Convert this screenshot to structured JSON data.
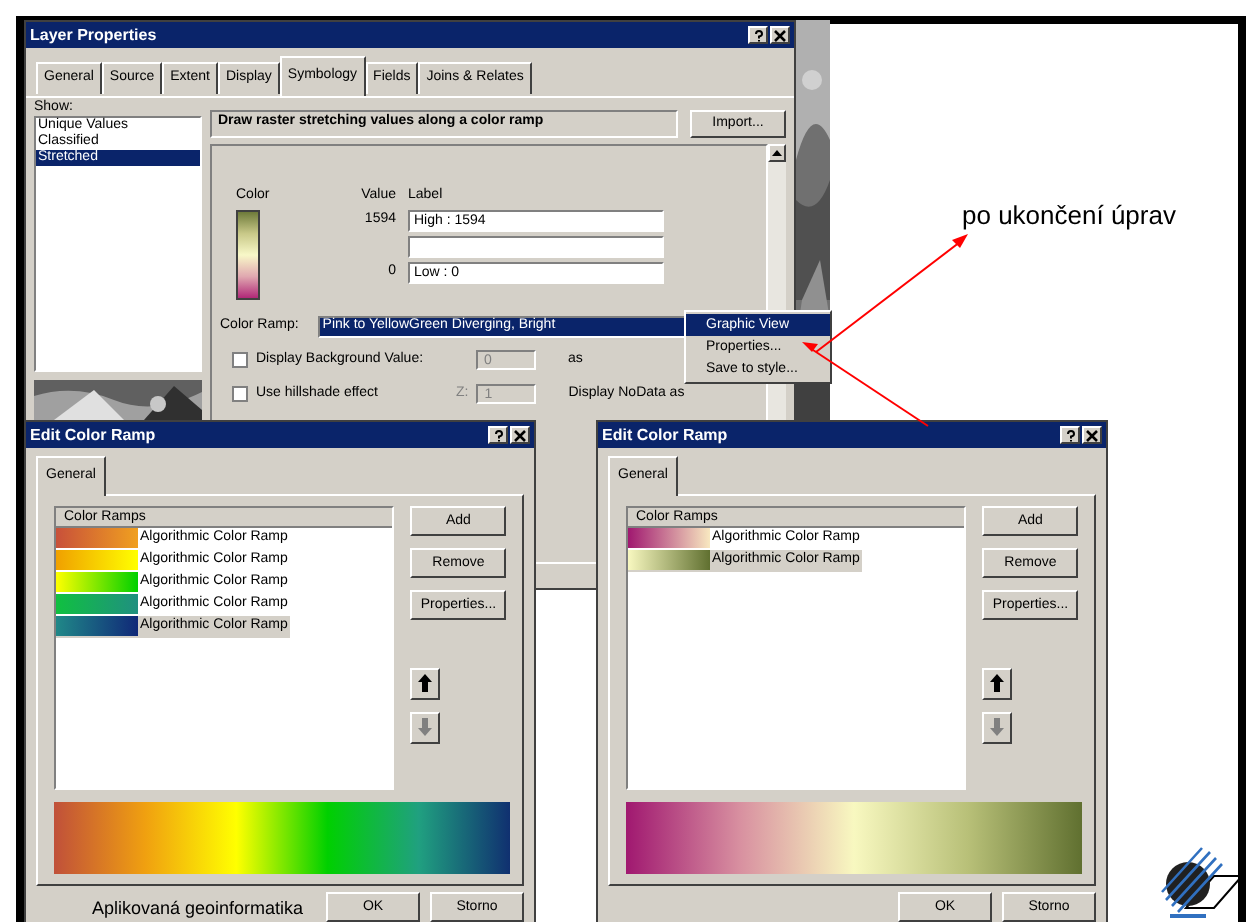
{
  "layer_properties": {
    "title": "Layer Properties",
    "tabs": [
      {
        "label": "General",
        "selected": false
      },
      {
        "label": "Source",
        "selected": false
      },
      {
        "label": "Extent",
        "selected": false
      },
      {
        "label": "Display",
        "selected": false
      },
      {
        "label": "Symbology",
        "selected": true
      },
      {
        "label": "Fields",
        "selected": false
      },
      {
        "label": "Joins & Relates",
        "selected": false
      }
    ],
    "show_label": "Show:",
    "show_items": [
      {
        "label": "Unique Values",
        "selected": false
      },
      {
        "label": "Classified",
        "selected": false
      },
      {
        "label": "Stretched",
        "selected": true
      }
    ],
    "header": "Draw raster stretching values along a color ramp",
    "import_button": "Import...",
    "color_header": "Color",
    "value_header": "Value",
    "label_header": "Label",
    "rows": [
      {
        "kind": "value",
        "value": "1594",
        "label": "High : 1594"
      },
      {
        "kind": "blank"
      },
      {
        "kind": "value",
        "value": "0",
        "label": "Low : 0"
      }
    ],
    "color_ramp_label": "Color Ramp:",
    "color_ramp_value": "Pink to YellowGreen Diverging, Bright",
    "options": [
      {
        "label": "Display Background Value:",
        "checked": false,
        "field": "0",
        "suffix": "as"
      },
      {
        "label": "Use hillshade effect",
        "checked": false,
        "z_label": "Z:",
        "field": "1",
        "suffix": "Display NoData as"
      }
    ],
    "menu": [
      {
        "label": "Graphic View",
        "selected": true
      },
      {
        "label": "Properties...",
        "selected": false
      },
      {
        "label": "Save to style...",
        "selected": false
      }
    ]
  },
  "edit_dialogs": [
    {
      "title": "Edit Color Ramp",
      "tab": "General",
      "list_header": "Color Ramps",
      "ramps": [
        {
          "label": "Algorithmic Color Ramp",
          "selected": false
        },
        {
          "label": "Algorithmic Color Ramp",
          "selected": false
        },
        {
          "label": "Algorithmic Color Ramp",
          "selected": false
        },
        {
          "label": "Algorithmic Color Ramp",
          "selected": false
        },
        {
          "label": "Algorithmic Color Ramp",
          "selected": true
        }
      ],
      "buttons": [
        "Add",
        "Remove",
        "Properties..."
      ],
      "ok": "OK",
      "cancel": "Storno"
    },
    {
      "title": "Edit Color Ramp",
      "tab": "General",
      "list_header": "Color Ramps",
      "ramps": [
        {
          "label": "Algorithmic Color Ramp",
          "selected": false
        },
        {
          "label": "Algorithmic Color Ramp",
          "selected": true
        }
      ],
      "buttons": [
        "Add",
        "Remove",
        "Properties..."
      ],
      "ok": "OK",
      "cancel": "Storno"
    }
  ],
  "annotation": "po ukončení úprav",
  "footer": "Aplikovaná geoinformatika"
}
